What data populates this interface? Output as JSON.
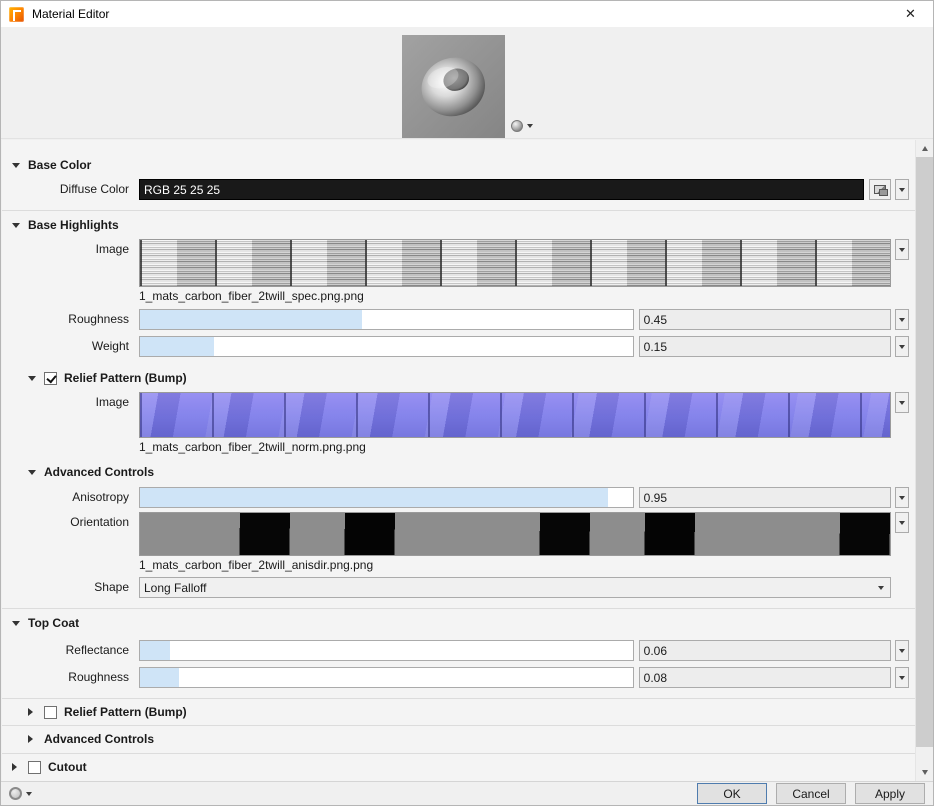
{
  "window": {
    "title": "Material Editor"
  },
  "icons": {
    "close": "✕"
  },
  "sections": {
    "base_color": {
      "title": "Base Color"
    },
    "base_highlights": {
      "title": "Base Highlights"
    },
    "relief_bump_top": {
      "title": "Relief Pattern (Bump)",
      "checked": true
    },
    "advanced_controls_top": {
      "title": "Advanced Controls"
    },
    "top_coat": {
      "title": "Top Coat"
    },
    "relief_bump_bottom": {
      "title": "Relief Pattern (Bump)",
      "checked": false
    },
    "advanced_controls_bottom": {
      "title": "Advanced Controls"
    },
    "cutout": {
      "title": "Cutout",
      "checked": false
    }
  },
  "fields": {
    "diffuse_color": {
      "label": "Diffuse Color",
      "value": "RGB 25 25 25"
    },
    "highlight_image": {
      "label": "Image",
      "filename": "1_mats_carbon_fiber_2twill_spec.png.png"
    },
    "highlight_roughness": {
      "label": "Roughness",
      "value": "0.45",
      "fill_percent": 45
    },
    "highlight_weight": {
      "label": "Weight",
      "value": "0.15",
      "fill_percent": 15
    },
    "bump_image": {
      "label": "Image",
      "filename": "1_mats_carbon_fiber_2twill_norm.png.png"
    },
    "anisotropy": {
      "label": "Anisotropy",
      "value": "0.95",
      "fill_percent": 95
    },
    "orientation": {
      "label": "Orientation",
      "filename": "1_mats_carbon_fiber_2twill_anisdir.png.png"
    },
    "shape": {
      "label": "Shape",
      "value": "Long Falloff"
    },
    "reflectance": {
      "label": "Reflectance",
      "value": "0.06",
      "fill_percent": 6
    },
    "topcoat_roughness": {
      "label": "Roughness",
      "value": "0.08",
      "fill_percent": 8
    }
  },
  "footer": {
    "ok": "OK",
    "cancel": "Cancel",
    "apply": "Apply"
  }
}
